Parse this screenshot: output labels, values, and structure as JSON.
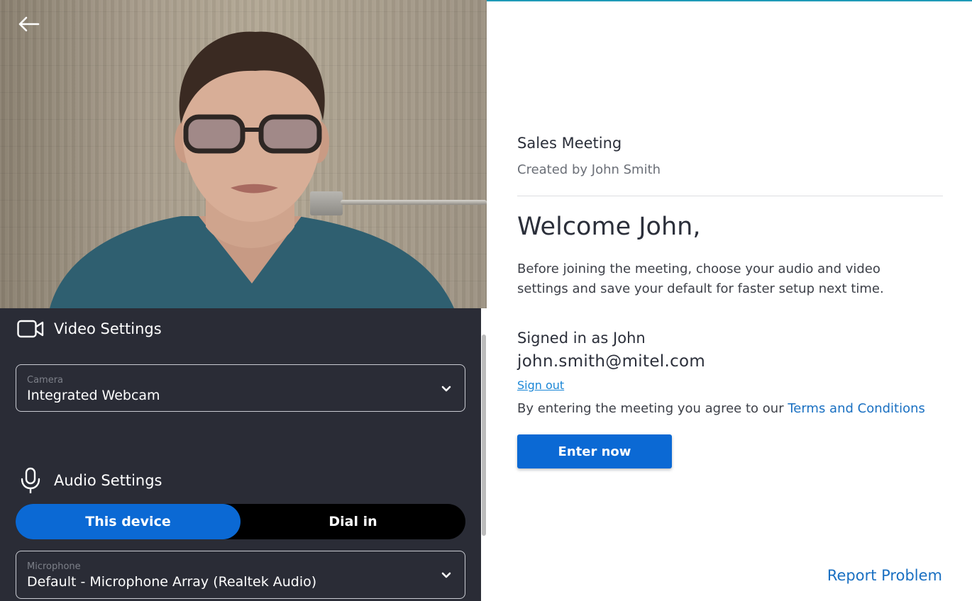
{
  "meeting": {
    "title": "Sales Meeting",
    "creator": "Created by John Smith"
  },
  "welcome": {
    "heading": "Welcome John,",
    "intro_line1": "Before joining the meeting, choose your audio and video",
    "intro_line2": "settings and save your default for faster setup next time."
  },
  "account": {
    "signed_in_label": "Signed in as John",
    "email": "john.smith@mitel.com",
    "sign_out_label": "Sign out"
  },
  "terms": {
    "prefix": "By entering the meeting you agree to our",
    "link_label": "Terms and Conditions"
  },
  "actions": {
    "enter_label": "Enter now",
    "report_label": "Report Problem"
  },
  "video_settings": {
    "heading": "Video Settings",
    "camera_caption": "Camera",
    "camera_value": "Integrated Webcam"
  },
  "audio_settings": {
    "heading": "Audio Settings",
    "options": [
      "This device",
      "Dial in"
    ],
    "selected_option": "This device",
    "microphone_caption": "Microphone",
    "microphone_value": "Default - Microphone Array (Realtek Audio)"
  },
  "icons": {
    "back": "arrow-left-icon",
    "video": "video-camera-icon",
    "audio": "microphone-icon",
    "dropdown": "chevron-down-icon"
  },
  "colors": {
    "primary": "#0b69d4",
    "link": "#1a70c2",
    "panel_bg": "#2a2c36",
    "accent_line": "#1f9bb8"
  }
}
